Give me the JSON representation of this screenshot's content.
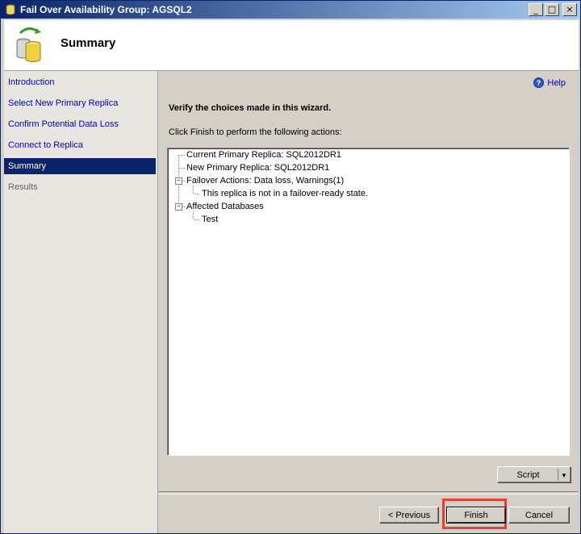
{
  "window": {
    "title": "Fail Over Availability Group: AGSQL2",
    "controls": {
      "minimize": "_",
      "maximize": "□",
      "close": "×"
    }
  },
  "header": {
    "title": "Summary",
    "icon": "database-sync-icon"
  },
  "sidebar": {
    "items": [
      {
        "label": "Introduction",
        "state": "link"
      },
      {
        "label": "Select New Primary Replica",
        "state": "link"
      },
      {
        "label": "Confirm Potential Data Loss",
        "state": "link"
      },
      {
        "label": "Connect to Replica",
        "state": "link"
      },
      {
        "label": "Summary",
        "state": "active"
      },
      {
        "label": "Results",
        "state": "disabled"
      }
    ]
  },
  "content": {
    "help": "Help",
    "heading": "Verify the choices made in this wizard.",
    "subtext": "Click Finish to perform the following actions:",
    "tree": {
      "nodes": [
        {
          "text": "Current Primary Replica: SQL2012DR1"
        },
        {
          "text": "New Primary Replica: SQL2012DR1"
        },
        {
          "text": "Failover Actions: Data loss, Warnings(1)",
          "expanded": true
        },
        {
          "text": "This replica is not in a failover-ready state."
        },
        {
          "text": "Affected Databases",
          "expanded": true
        },
        {
          "text": "Test"
        }
      ],
      "expander_symbol": "−"
    },
    "script_button": "Script",
    "script_arrow": "▼"
  },
  "footer": {
    "previous": "< Previous",
    "finish": "Finish",
    "cancel": "Cancel"
  },
  "colors": {
    "highlight": "#e8402a",
    "active_nav": "#0a246a",
    "link": "#0000c0"
  }
}
